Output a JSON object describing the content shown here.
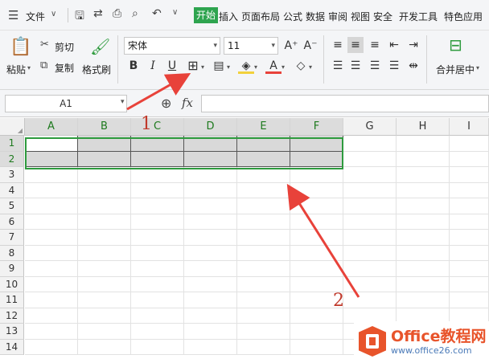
{
  "menubar": {
    "menu_label": "文件",
    "tabs": [
      "开始",
      "插入",
      "页面布局",
      "公式",
      "数据",
      "审阅",
      "视图",
      "安全",
      "开发工具",
      "特色应用"
    ],
    "active_tab": "开始"
  },
  "ribbon": {
    "paste": "粘贴",
    "cut": "剪切",
    "copy": "复制",
    "format_painter": "格式刷",
    "font_name": "宋体",
    "font_size": "11",
    "bold": "B",
    "italic": "I",
    "underline": "U",
    "font_color_letter": "A",
    "merge_center": "合并居中"
  },
  "formula": {
    "name_box": "A1",
    "fx": "fx",
    "content": ""
  },
  "grid": {
    "columns": [
      "A",
      "B",
      "C",
      "D",
      "E",
      "F",
      "G",
      "H",
      "I"
    ],
    "rows": [
      "1",
      "2",
      "3",
      "4",
      "5",
      "6",
      "7",
      "8",
      "9",
      "10",
      "11",
      "12",
      "13",
      "14"
    ],
    "selection": "A1:F2"
  },
  "annotations": {
    "label1": "1",
    "label2": "2"
  },
  "watermark": {
    "brand": "Office教程网",
    "url": "www.office26.com"
  },
  "colors": {
    "accent_green": "#2ea44f",
    "arrow_red": "#e8423a",
    "selection_border": "#2e9b3e"
  }
}
